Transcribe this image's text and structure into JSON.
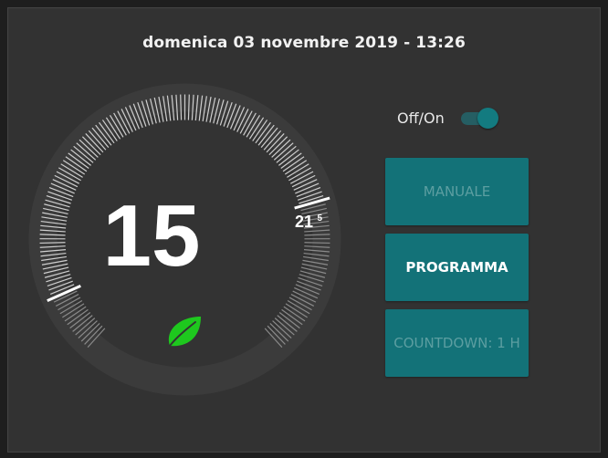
{
  "header": {
    "datetime": "domenica 03 novembre 2019 - 13:26"
  },
  "thermostat": {
    "current_temp": "15",
    "setpoint": "21",
    "setpoint_decimal": "5",
    "eco_icon": "leaf-icon",
    "colors": {
      "ticks": "#cfcfcf",
      "ticks_dim": "#8a8a8a",
      "face": "#333333",
      "ring": "#3d3d3d",
      "leaf": "#1ec81e"
    }
  },
  "power": {
    "label": "Off/On",
    "state": "on"
  },
  "modes": {
    "manual_label": "MANUALE",
    "program_label": "PROGRAMMA",
    "countdown_label": "COUNTDOWN: 1 H",
    "active": "PROGRAMMA"
  },
  "colors": {
    "accent": "#137278",
    "background": "#323232"
  }
}
